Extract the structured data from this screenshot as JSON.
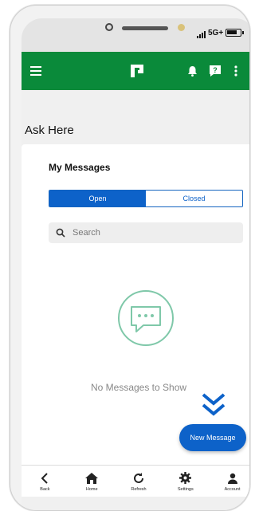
{
  "status_bar": {
    "network": "5G+"
  },
  "app_bar": {
    "menu_icon": "hamburger-icon",
    "logo_icon": "app-logo-icon",
    "bell_icon": "bell-icon",
    "help_icon": "help-icon",
    "more_icon": "more-vertical-icon",
    "color": "#0a8a3a"
  },
  "page": {
    "title": "Ask Here"
  },
  "messages": {
    "title": "My Messages",
    "tabs": [
      {
        "label": "Open",
        "selected": true
      },
      {
        "label": "Closed",
        "selected": false
      }
    ],
    "search_placeholder": "Search",
    "empty_text": "No Messages to Show",
    "new_message_label": "New Message"
  },
  "bottom_nav": [
    {
      "label": "Back",
      "icon": "back-icon"
    },
    {
      "label": "Home",
      "icon": "home-icon"
    },
    {
      "label": "Refresh",
      "icon": "refresh-icon"
    },
    {
      "label": "Settings",
      "icon": "settings-icon"
    },
    {
      "label": "Account",
      "icon": "account-icon"
    }
  ],
  "colors": {
    "accent": "#0d62c9",
    "brand_green": "#0a8a3a",
    "empty_icon": "#7fc8a9"
  }
}
